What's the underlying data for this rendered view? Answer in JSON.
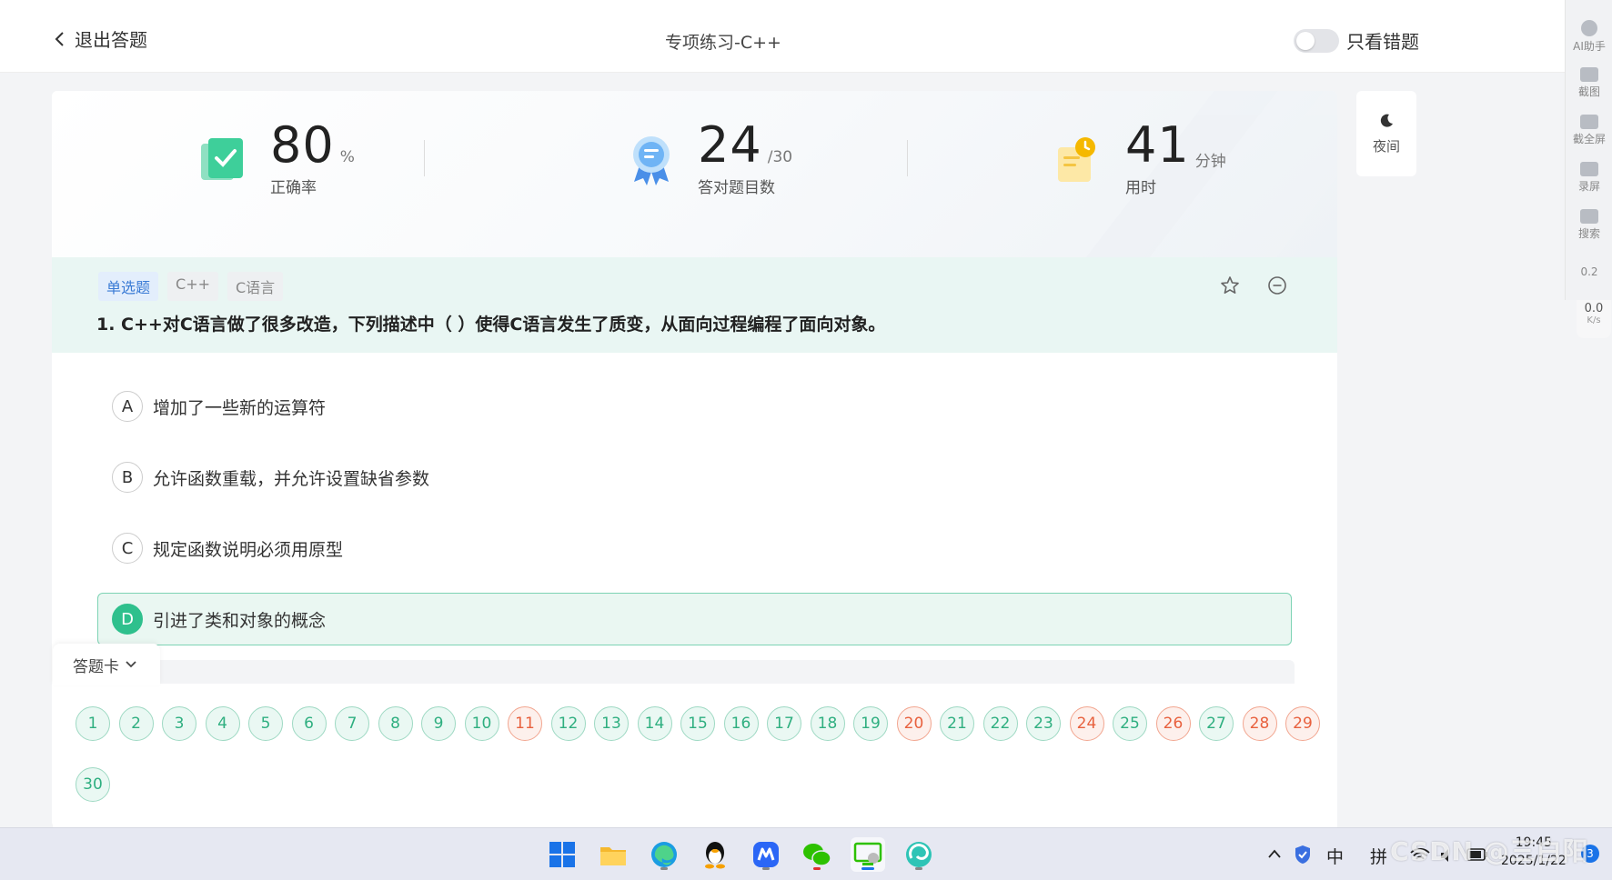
{
  "header": {
    "back_label": "退出答题",
    "title": "专项练习-C++",
    "wrong_only_label": "只看错题"
  },
  "stats": {
    "accuracy": {
      "value": "80",
      "unit": "%",
      "label": "正确率"
    },
    "correct": {
      "value": "24",
      "unit": "/30",
      "label": "答对题目数"
    },
    "time": {
      "value": "41",
      "unit": "分钟",
      "label": "用时"
    }
  },
  "question": {
    "tags": [
      "单选题",
      "C++",
      "C语言"
    ],
    "text": "1. C++对C语言做了很多改造，下列描述中（      ）使得C语言发生了质变，从面向过程编程了面向对象。",
    "options": [
      {
        "letter": "A",
        "text": "增加了一些新的运算符",
        "selected": false
      },
      {
        "letter": "B",
        "text": "允许函数重载，并允许设置缺省参数",
        "selected": false
      },
      {
        "letter": "C",
        "text": "规定函数说明必须用原型",
        "selected": false
      },
      {
        "letter": "D",
        "text": "引进了类和对象的概念",
        "selected": true
      }
    ]
  },
  "answer_card": {
    "label": "答题卡",
    "items": [
      {
        "n": "1",
        "status": "correct"
      },
      {
        "n": "2",
        "status": "correct"
      },
      {
        "n": "3",
        "status": "correct"
      },
      {
        "n": "4",
        "status": "correct"
      },
      {
        "n": "5",
        "status": "correct"
      },
      {
        "n": "6",
        "status": "correct"
      },
      {
        "n": "7",
        "status": "correct"
      },
      {
        "n": "8",
        "status": "correct"
      },
      {
        "n": "9",
        "status": "correct"
      },
      {
        "n": "10",
        "status": "correct"
      },
      {
        "n": "11",
        "status": "wrong"
      },
      {
        "n": "12",
        "status": "correct"
      },
      {
        "n": "13",
        "status": "correct"
      },
      {
        "n": "14",
        "status": "correct"
      },
      {
        "n": "15",
        "status": "correct"
      },
      {
        "n": "16",
        "status": "correct"
      },
      {
        "n": "17",
        "status": "correct"
      },
      {
        "n": "18",
        "status": "correct"
      },
      {
        "n": "19",
        "status": "correct"
      },
      {
        "n": "20",
        "status": "wrong"
      },
      {
        "n": "21",
        "status": "correct"
      },
      {
        "n": "22",
        "status": "correct"
      },
      {
        "n": "23",
        "status": "correct"
      },
      {
        "n": "24",
        "status": "wrong"
      },
      {
        "n": "25",
        "status": "correct"
      },
      {
        "n": "26",
        "status": "wrong"
      },
      {
        "n": "27",
        "status": "correct"
      },
      {
        "n": "28",
        "status": "wrong"
      },
      {
        "n": "29",
        "status": "wrong"
      },
      {
        "n": "30",
        "status": "correct"
      }
    ]
  },
  "side": {
    "night_label": "夜间",
    "tools": [
      "AI助手",
      "截图",
      "截全屏",
      "录屏",
      "搜索"
    ],
    "net_up": "0.2",
    "net_down": "0.0",
    "net_unit": "K/s"
  },
  "taskbar": {
    "ime_1": "中",
    "ime_2": "拼",
    "time": "19:45",
    "date": "2025/1/22",
    "notification_count": "3"
  },
  "watermark": "CSDN @三白阳",
  "colors": {
    "accent_green": "#2fc08d",
    "wrong_red": "#e8613e",
    "tag_blue": "#3a7bd5"
  }
}
